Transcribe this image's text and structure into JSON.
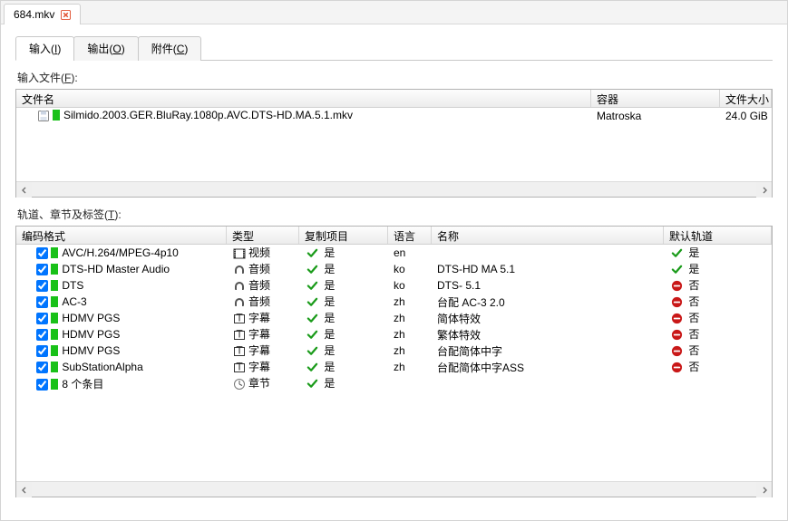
{
  "file_tab": {
    "title": "684.mkv"
  },
  "inner_tabs": [
    {
      "label_pre": "输入(",
      "hot": "I",
      "label_post": ")"
    },
    {
      "label_pre": "输出(",
      "hot": "O",
      "label_post": ")"
    },
    {
      "label_pre": "附件(",
      "hot": "C",
      "label_post": ")"
    }
  ],
  "labels": {
    "input_files_pre": "输入文件(",
    "input_files_hot": "F",
    "input_files_post": "):",
    "tracks_pre": "轨道、章节及标签(",
    "tracks_hot": "T",
    "tracks_post": "):"
  },
  "files_headers": {
    "name": "文件名",
    "container": "容器",
    "size": "文件大小"
  },
  "files": [
    {
      "name": "Silmido.2003.GER.BluRay.1080p.AVC.DTS-HD.MA.5.1.mkv",
      "container": "Matroska",
      "size": "24.0 GiB"
    }
  ],
  "tracks_headers": {
    "codec": "编码格式",
    "type": "类型",
    "copy": "复制项目",
    "lang": "语言",
    "name": "名称",
    "def": "默认轨道"
  },
  "yes": "是",
  "no": "否",
  "type_names": {
    "video": "视频",
    "audio": "音频",
    "sub": "字幕",
    "chap": "章节"
  },
  "tracks": [
    {
      "codec": "AVC/H.264/MPEG-4p10",
      "type": "video",
      "copy": true,
      "lang": "en",
      "name": "",
      "def": "yes"
    },
    {
      "codec": "DTS-HD Master Audio",
      "type": "audio",
      "copy": true,
      "lang": "ko",
      "name": "DTS-HD MA 5.1",
      "def": "yes"
    },
    {
      "codec": "DTS",
      "type": "audio",
      "copy": true,
      "lang": "ko",
      "name": "DTS- 5.1",
      "def": "no"
    },
    {
      "codec": "AC-3",
      "type": "audio",
      "copy": true,
      "lang": "zh",
      "name": "台配 AC-3 2.0",
      "def": "no"
    },
    {
      "codec": "HDMV PGS",
      "type": "sub",
      "copy": true,
      "lang": "zh",
      "name": "简体特效",
      "def": "no"
    },
    {
      "codec": "HDMV PGS",
      "type": "sub",
      "copy": true,
      "lang": "zh",
      "name": "繁体特效",
      "def": "no"
    },
    {
      "codec": "HDMV PGS",
      "type": "sub",
      "copy": true,
      "lang": "zh",
      "name": "台配简体中字",
      "def": "no"
    },
    {
      "codec": "SubStationAlpha",
      "type": "sub",
      "copy": true,
      "lang": "zh",
      "name": "台配简体中字ASS",
      "def": "no"
    },
    {
      "codec": "8 个条目",
      "type": "chap",
      "copy": true,
      "lang": "",
      "name": "",
      "def": ""
    }
  ]
}
